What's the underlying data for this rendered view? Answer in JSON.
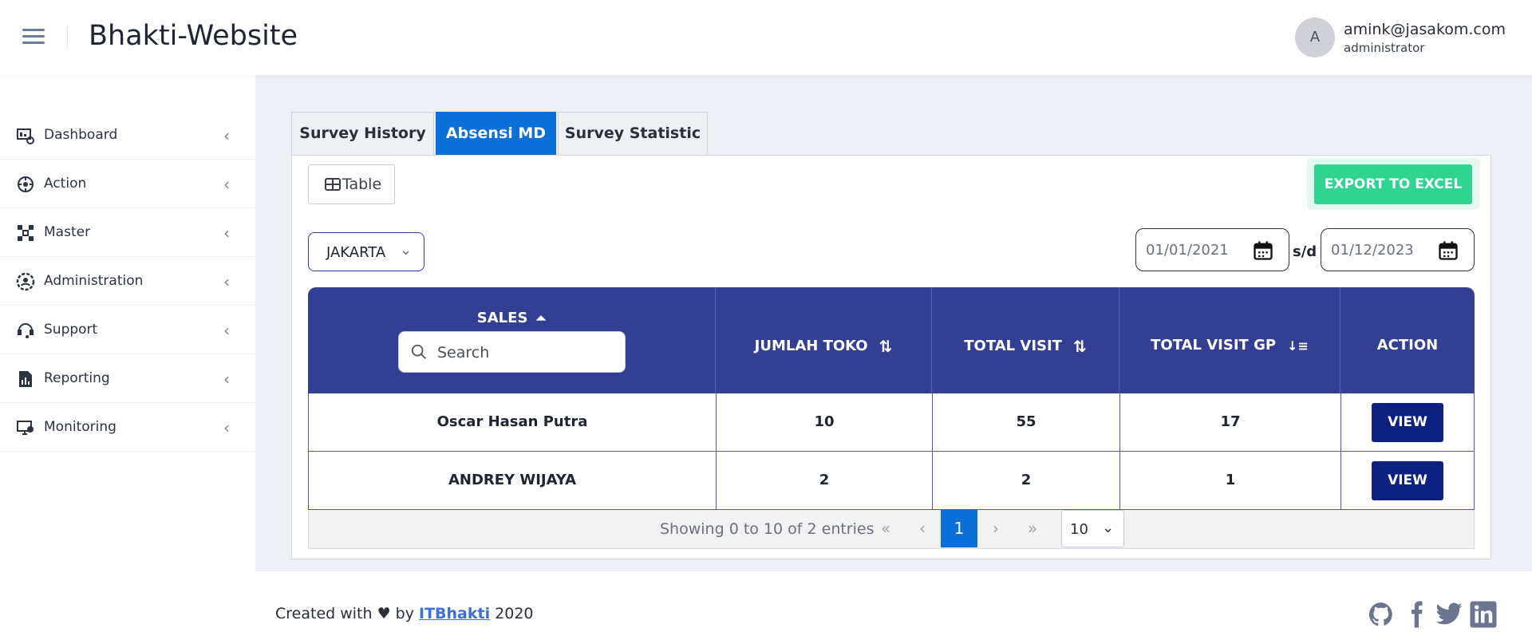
{
  "header": {
    "app_title": "Bhakti-Website",
    "user_initial": "A",
    "user_email": "amink@jasakom.com",
    "user_role": "administrator"
  },
  "sidebar": {
    "items": [
      {
        "label": "Dashboard",
        "icon": "dashboard-icon"
      },
      {
        "label": "Action",
        "icon": "action-icon"
      },
      {
        "label": "Master",
        "icon": "master-icon"
      },
      {
        "label": "Administration",
        "icon": "administration-icon"
      },
      {
        "label": "Support",
        "icon": "support-icon"
      },
      {
        "label": "Reporting",
        "icon": "reporting-icon"
      },
      {
        "label": "Monitoring",
        "icon": "monitoring-icon"
      }
    ]
  },
  "tabs": [
    {
      "label": "Survey History",
      "active": false
    },
    {
      "label": "Absensi MD",
      "active": true
    },
    {
      "label": "Survey Statistic",
      "active": false
    }
  ],
  "toolbar": {
    "table_label": "Table",
    "export_label": "EXPORT TO EXCEL"
  },
  "filters": {
    "city": "JAKARTA",
    "date_from": "01/01/2021",
    "separator": "s/d",
    "date_to": "01/12/2023"
  },
  "table": {
    "columns": [
      "SALES",
      "JUMLAH TOKO",
      "TOTAL VISIT",
      "TOTAL VISIT GP",
      "ACTION"
    ],
    "search_placeholder": "Search",
    "rows": [
      {
        "sales": "Oscar Hasan Putra",
        "jumlah_toko": "10",
        "total_visit": "55",
        "total_visit_gp": "17",
        "action": "VIEW"
      },
      {
        "sales": "ANDREY WIJAYA",
        "jumlah_toko": "2",
        "total_visit": "2",
        "total_visit_gp": "1",
        "action": "VIEW"
      }
    ],
    "showing": "Showing 0 to 10 of 2 entries",
    "current_page": "1",
    "per_page": "10"
  },
  "footer": {
    "prefix": "Created with ♥ by",
    "link": "ITBhakti",
    "year": "2020"
  },
  "colors": {
    "header_bg": "#323f93",
    "tab_active": "#0a6fd6",
    "export_btn": "#2ed48f",
    "view_btn": "#0f2180"
  }
}
